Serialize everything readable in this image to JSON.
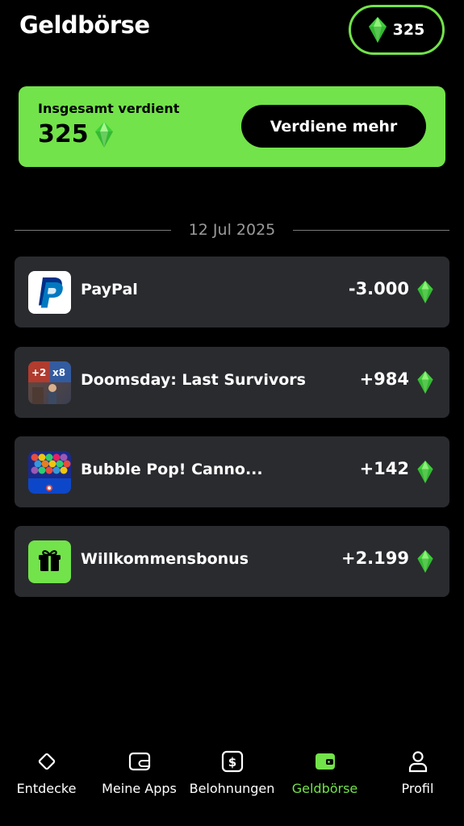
{
  "header": {
    "title": "Geldbörse",
    "balance": "325",
    "balance_icon": "gem-icon"
  },
  "earned": {
    "label": "Insgesamt verdient",
    "value": "325",
    "button_label": "Verdiene mehr"
  },
  "date": "12 Jul 2025",
  "transactions": [
    {
      "name": "PayPal",
      "amount": "-3.000",
      "icon": "paypal-icon"
    },
    {
      "name": "Doomsday: Last Survivors",
      "amount": "+984",
      "icon": "doomsday-app-icon"
    },
    {
      "name": "Bubble Pop! Canno...",
      "amount": "+142",
      "icon": "bubble-pop-app-icon"
    },
    {
      "name": "Willkommensbonus",
      "amount": "+2.199",
      "icon": "gift-icon"
    }
  ],
  "nav": [
    {
      "label": "Entdecke",
      "icon": "diamond-outline-icon",
      "active": false
    },
    {
      "label": "Meine Apps",
      "icon": "wallet-outline-icon",
      "active": false
    },
    {
      "label": "Belohnungen",
      "icon": "dollar-icon",
      "active": false
    },
    {
      "label": "Geldbörse",
      "icon": "wallet-filled-icon",
      "active": true
    },
    {
      "label": "Profil",
      "icon": "person-icon",
      "active": false
    }
  ],
  "colors": {
    "accent": "#72e34a",
    "card": "#2a2b2f",
    "background": "#000000"
  }
}
